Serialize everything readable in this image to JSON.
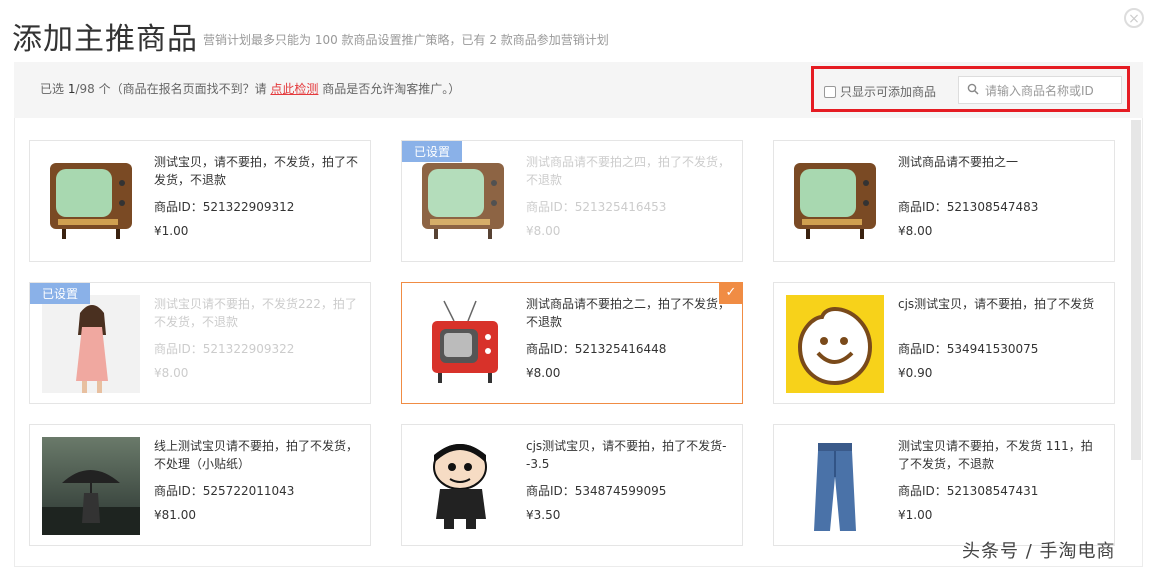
{
  "header": {
    "title": "添加主推商品",
    "subtitle": "营销计划最多只能为 100 款商品设置推广策略，已有 2 款商品参加营销计划",
    "close_label": "×"
  },
  "filter": {
    "selected_prefix": "已选 ",
    "selected_count": "1",
    "selected_suffix": "/98 个（商品在报名页面找不到？请 ",
    "check_link": "点此检测",
    "selected_tail": " 商品是否允许淘客推广。）",
    "only_addable_label": "只显示可添加商品",
    "search_placeholder": "请输入商品名称或ID"
  },
  "products": [
    {
      "name": "测试宝贝，请不要拍，不发货，拍了不发货，不退款",
      "id": "商品ID：521322909312",
      "price": "¥1.00",
      "badge": "",
      "image": "tv-brown"
    },
    {
      "name": "测试商品请不要拍之四，拍了不发货，不退款",
      "id": "商品ID：521325416453",
      "price": "¥8.00",
      "badge": "已设置",
      "image": "tv-brown"
    },
    {
      "name": "测试商品请不要拍之一",
      "id": "商品ID：521308547483",
      "price": "¥8.00",
      "badge": "",
      "image": "tv-brown"
    },
    {
      "name": "测试宝贝请不要拍，不发货222，拍了不发货，不退款",
      "id": "商品ID：521322909322",
      "price": "¥8.00",
      "badge": "已设置",
      "image": "dress-woman"
    },
    {
      "name": "测试商品请不要拍之二，拍了不发货，不退款",
      "id": "商品ID：521325416448",
      "price": "¥8.00",
      "badge": "",
      "image": "tv-red"
    },
    {
      "name": "cjs测试宝贝，请不要拍，拍了不发货",
      "id": "商品ID：534941530075",
      "price": "¥0.90",
      "badge": "",
      "image": "smiley-sticker"
    },
    {
      "name": "线上测试宝贝请不要拍，拍了不发货，不处理（小贴纸）",
      "id": "商品ID：525722011043",
      "price": "¥81.00",
      "badge": "",
      "image": "umbrella-photo"
    },
    {
      "name": "cjs测试宝贝，请不要拍，拍了不发货--3.5",
      "id": "商品ID：534874599095",
      "price": "¥3.50",
      "badge": "",
      "image": "cartoon-boy"
    },
    {
      "name": "测试宝贝请不要拍，不发货 111，拍了不发货，不退款",
      "id": "商品ID：521308547431",
      "price": "¥1.00",
      "badge": "",
      "image": "jeans"
    }
  ],
  "watermark": "头条号 / 手淘电商",
  "colors": {
    "accent": "#f08c44",
    "link": "#e4393c",
    "badge": "#8ab1e8",
    "highlight": "#e51c23"
  }
}
